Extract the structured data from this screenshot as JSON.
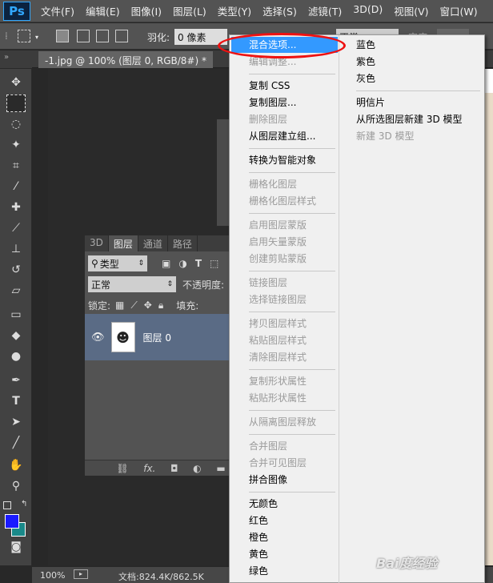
{
  "menubar": {
    "logo": "Ps",
    "items": [
      "文件(F)",
      "编辑(E)",
      "图像(I)",
      "图层(L)",
      "类型(Y)",
      "选择(S)",
      "滤镜(T)",
      "3D(D)",
      "视图(V)",
      "窗口(W)"
    ]
  },
  "options": {
    "feather_label": "羽化:",
    "feather_value": "0 像素",
    "style_value": "正常",
    "width_label": "宽度"
  },
  "document_tab": "-1.jpg @ 100% (图层 0, RGB/8#) *",
  "collapse_label": "»",
  "layers_panel": {
    "tabs": [
      "3D",
      "图层",
      "通道",
      "路径"
    ],
    "filter_value": "类型",
    "blend_mode": "正常",
    "opacity_label": "不透明度:",
    "lock_label": "锁定:",
    "fill_label": "填充:",
    "layer_name": "图层 0"
  },
  "status": {
    "zoom": "100%",
    "doc_info": "文档:824.4K/862.5K"
  },
  "context_menu": {
    "col1": [
      {
        "label": "混合选项...",
        "state": "highlighted"
      },
      {
        "label": "编辑调整...",
        "state": "disabled"
      },
      {
        "sep": true
      },
      {
        "label": "复制 CSS",
        "state": "enabled"
      },
      {
        "label": "复制图层...",
        "state": "enabled"
      },
      {
        "label": "删除图层",
        "state": "disabled"
      },
      {
        "label": "从图层建立组...",
        "state": "enabled"
      },
      {
        "sep": true
      },
      {
        "label": "转换为智能对象",
        "state": "enabled"
      },
      {
        "sep": true
      },
      {
        "label": "栅格化图层",
        "state": "disabled"
      },
      {
        "label": "栅格化图层样式",
        "state": "disabled"
      },
      {
        "sep": true
      },
      {
        "label": "启用图层蒙版",
        "state": "disabled"
      },
      {
        "label": "启用矢量蒙版",
        "state": "disabled"
      },
      {
        "label": "创建剪贴蒙版",
        "state": "disabled"
      },
      {
        "sep": true
      },
      {
        "label": "链接图层",
        "state": "disabled"
      },
      {
        "label": "选择链接图层",
        "state": "disabled"
      },
      {
        "sep": true
      },
      {
        "label": "拷贝图层样式",
        "state": "disabled"
      },
      {
        "label": "粘贴图层样式",
        "state": "disabled"
      },
      {
        "label": "清除图层样式",
        "state": "disabled"
      },
      {
        "sep": true
      },
      {
        "label": "复制形状属性",
        "state": "disabled"
      },
      {
        "label": "粘贴形状属性",
        "state": "disabled"
      },
      {
        "sep": true
      },
      {
        "label": "从隔离图层释放",
        "state": "disabled"
      },
      {
        "sep": true
      },
      {
        "label": "合并图层",
        "state": "disabled"
      },
      {
        "label": "合并可见图层",
        "state": "disabled"
      },
      {
        "label": "拼合图像",
        "state": "enabled"
      },
      {
        "sep": true
      },
      {
        "label": "无颜色",
        "state": "enabled"
      },
      {
        "label": "红色",
        "state": "enabled"
      },
      {
        "label": "橙色",
        "state": "enabled"
      },
      {
        "label": "黄色",
        "state": "enabled"
      },
      {
        "label": "绿色",
        "state": "enabled"
      }
    ],
    "col2": [
      {
        "label": "蓝色",
        "state": "enabled"
      },
      {
        "label": "紫色",
        "state": "enabled"
      },
      {
        "label": "灰色",
        "state": "enabled"
      },
      {
        "sep": true
      },
      {
        "label": "明信片",
        "state": "enabled"
      },
      {
        "label": "从所选图层新建 3D 模型",
        "state": "enabled"
      },
      {
        "label": "新建 3D 模型",
        "state": "disabled"
      }
    ]
  },
  "watermark": "Bai度经验",
  "colors": {
    "highlight": "#3399ff",
    "annotation_ring": "#ee1111",
    "foreground_swatch": "#1a1aff",
    "background_swatch": "#1a8a8a"
  }
}
